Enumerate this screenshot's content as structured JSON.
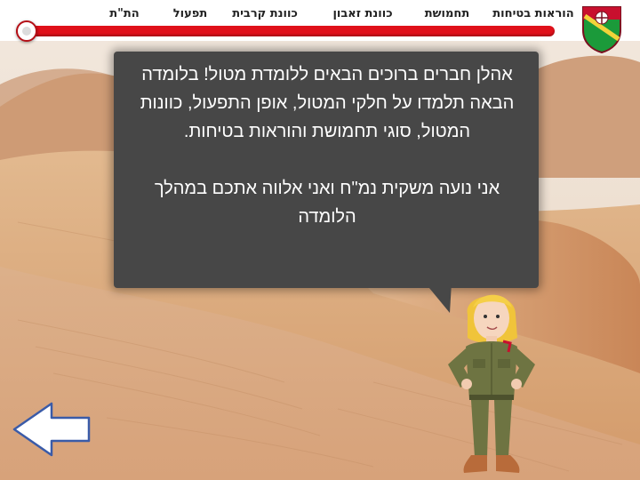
{
  "nav": {
    "items": [
      {
        "label": "הת\"ת"
      },
      {
        "label": "תפעול"
      },
      {
        "label": "כוונת קרבית"
      },
      {
        "label": "כוונת זאבון"
      },
      {
        "label": "תחמושת"
      },
      {
        "label": "הוראות בטיחות"
      }
    ]
  },
  "progress": {
    "value": 0
  },
  "bubble": {
    "paragraph1": "אהלן חברים ברוכים הבאים ללומדת מטול! בלומדה הבאה תלמדו על חלקי המטול, אופן התפעול, כוונות המטול, סוגי תחמושת והוראות בטיחות.",
    "paragraph2": "אני נועה משקית נמ\"ח ואני אלווה אתכם במהלך הלומדה"
  },
  "icons": {
    "emblem": "unit-emblem-icon",
    "back": "back-arrow-icon",
    "character": "soldier-guide-character"
  },
  "colors": {
    "accent": "#e0101a",
    "bubble_bg": "#474747",
    "sand_light": "#e8c9a3",
    "sand_dark": "#c8875a"
  }
}
